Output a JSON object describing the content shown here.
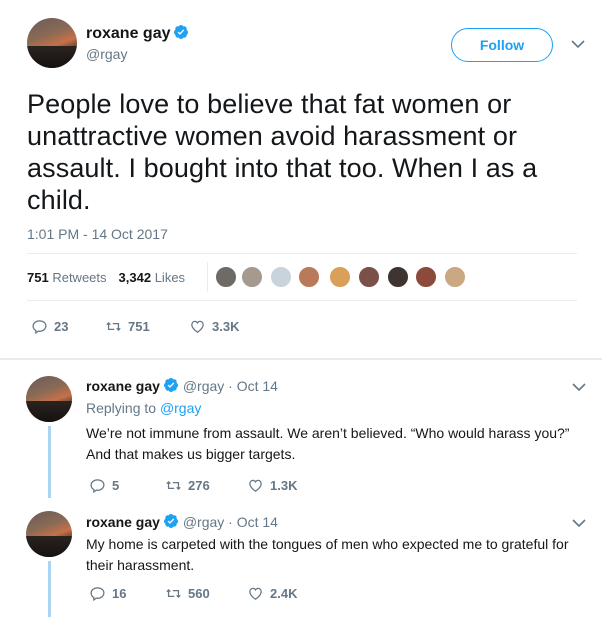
{
  "main": {
    "name": "roxane gay",
    "handle": "@rgay",
    "follow_label": "Follow",
    "text": "People love to believe that fat women or unattractive women avoid harassment or assault. I bought into that too. When I as a child.",
    "timestamp": "1:01 PM - 14 Oct 2017",
    "retweets_count": "751",
    "retweets_label": "Retweets",
    "likes_count": "3,342",
    "likes_label": "Likes",
    "actions": {
      "replies": "23",
      "retweets": "751",
      "likes": "3.3K"
    }
  },
  "replies": [
    {
      "name": "roxane gay",
      "handle": "@rgay · Oct 14",
      "replying_prefix": "Replying to ",
      "replying_to": "@rgay",
      "text": "We’re not immune from assault. We aren’t believed. “Who would harass you?” And that makes us bigger targets.",
      "actions": {
        "replies": "5",
        "retweets": "276",
        "likes": "1.3K"
      }
    },
    {
      "name": "roxane gay",
      "handle": "@rgay · Oct 14",
      "text": "My home is carpeted with the tongues of men who expected me to grateful for their harassment.",
      "actions": {
        "replies": "16",
        "retweets": "560",
        "likes": "2.4K"
      }
    }
  ],
  "colors": {
    "accent": "#1da1f2",
    "muted": "#657786",
    "text": "#14171a",
    "thread": "#a9d4f2"
  },
  "icons": [
    "verified-icon",
    "chevron-down-icon",
    "reply-icon",
    "retweet-icon",
    "like-icon"
  ]
}
